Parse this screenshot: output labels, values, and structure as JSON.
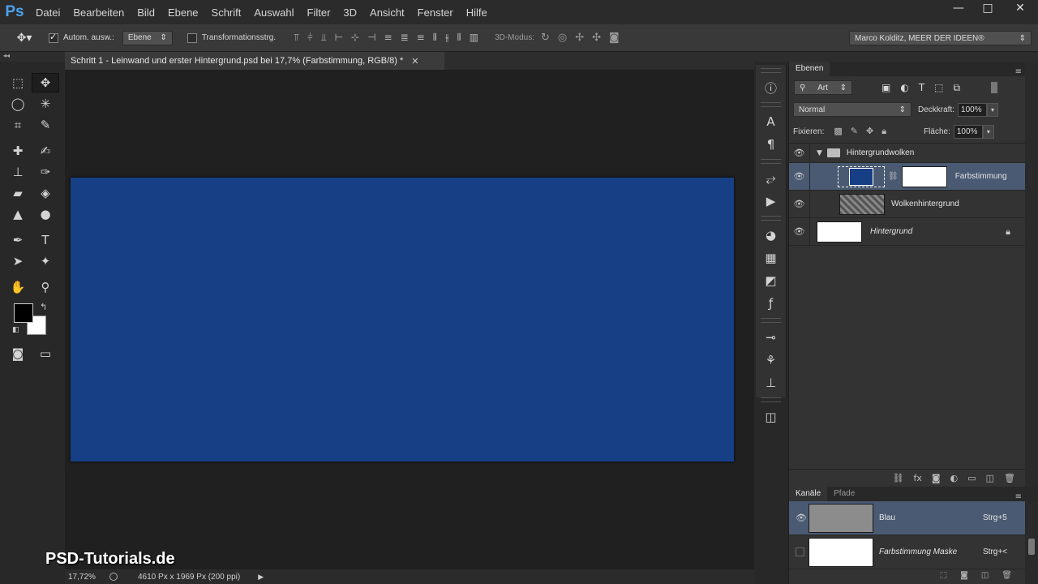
{
  "app": {
    "logo": "Ps"
  },
  "menu": [
    "Datei",
    "Bearbeiten",
    "Bild",
    "Ebene",
    "Schrift",
    "Auswahl",
    "Filter",
    "3D",
    "Ansicht",
    "Fenster",
    "Hilfe"
  ],
  "window_controls": {
    "minimize": "—",
    "maximize": "□",
    "close": "✕"
  },
  "options": {
    "auto_select_label": "Autom. ausw.:",
    "auto_select_checked": true,
    "auto_select_target": "Ebene",
    "transform_label": "Transformationsstrg.",
    "transform_checked": false,
    "mode_label": "3D-Modus:",
    "workspace": "Marco Kolditz, MEER DER IDEEN®"
  },
  "document": {
    "tab_title": "Schritt 1 - Leinwand und erster Hintergrund.psd bei 17,7% (Farbstimmung, RGB/8) *",
    "canvas_color": "#173f85"
  },
  "status": {
    "zoom": "17,72%",
    "info": "4610 Px x 1969 Px (200 ppi)"
  },
  "watermark": "PSD-Tutorials.de",
  "layers_panel": {
    "tab": "Ebenen",
    "filter": "Art",
    "blend_mode": "Normal",
    "opacity_label": "Deckkraft:",
    "opacity": "100%",
    "lock_label": "Fixieren:",
    "fill_label": "Fläche:",
    "fill": "100%",
    "layers": [
      {
        "name": "Hintergrundwolken",
        "type": "group",
        "visible": true
      },
      {
        "name": "Farbstimmung",
        "type": "adjustment",
        "visible": true,
        "selected": true
      },
      {
        "name": "Wolkenhintergrund",
        "type": "smart",
        "visible": true
      },
      {
        "name": "Hintergrund",
        "type": "background",
        "visible": true,
        "locked": true
      }
    ]
  },
  "channels_panel": {
    "tabs": [
      "Kanäle",
      "Pfade"
    ],
    "channels": [
      {
        "name": "Blau",
        "shortcut": "Strg+5",
        "selected": true,
        "visible": true
      },
      {
        "name": "Farbstimmung Maske",
        "shortcut": "Strg+<",
        "selected": false,
        "visible": false
      }
    ]
  }
}
